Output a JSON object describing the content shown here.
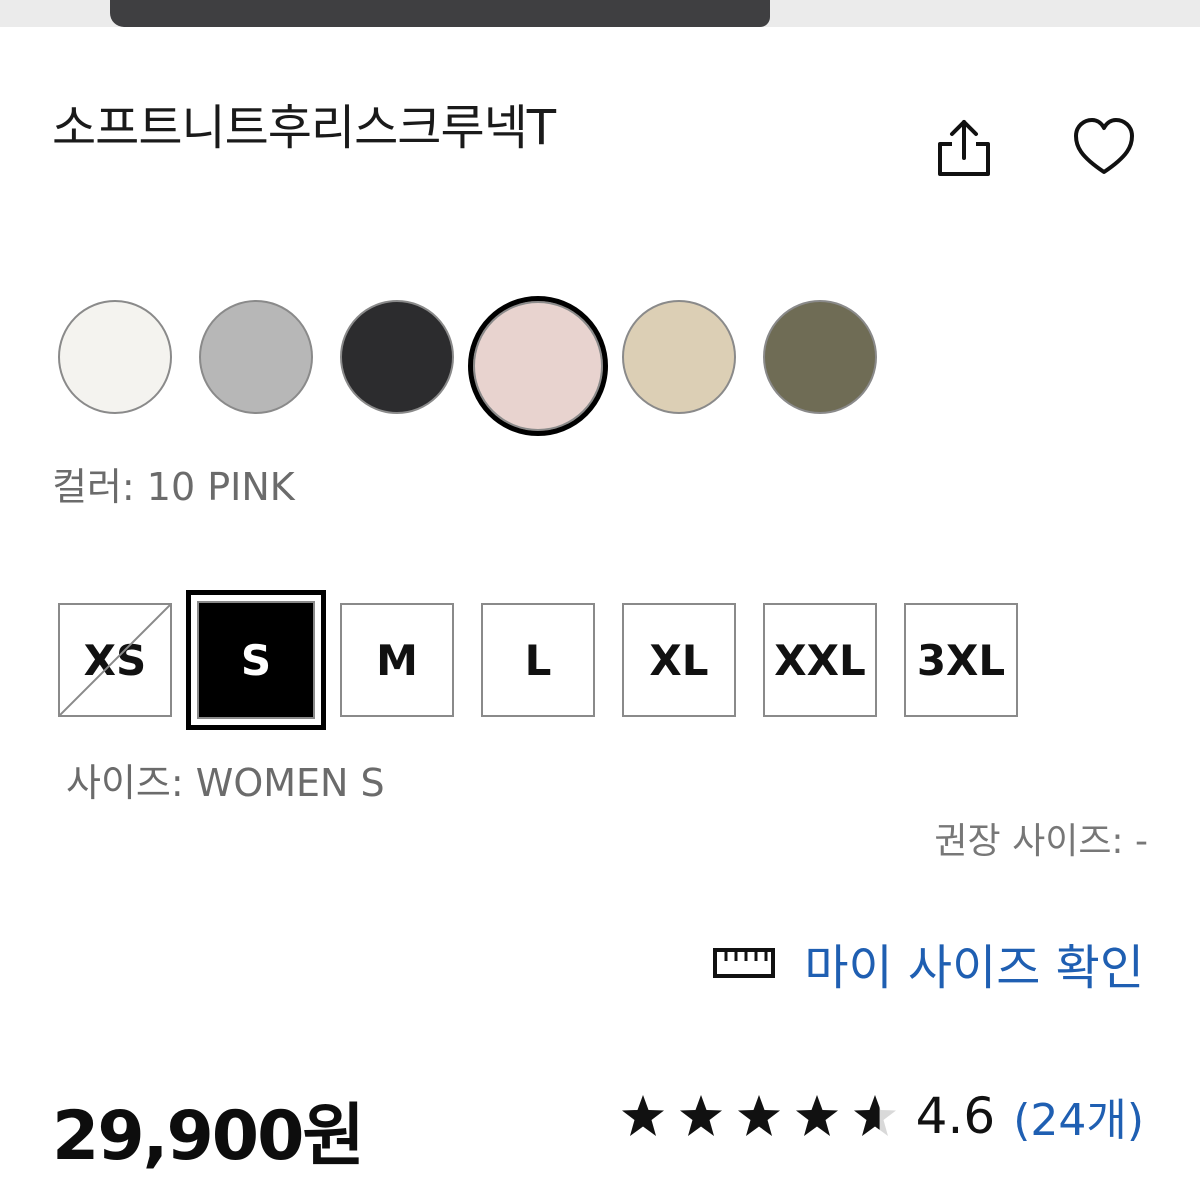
{
  "product": {
    "title": "소프트니트후리스크루넥T",
    "price": "29,900원"
  },
  "actions": {
    "share_icon": "share-icon",
    "favorite_icon": "heart-icon"
  },
  "colors": {
    "swatches": [
      {
        "name": "off-white",
        "color": "#f4f3ef"
      },
      {
        "name": "gray",
        "color": "#b7b7b7"
      },
      {
        "name": "black",
        "color": "#2c2c2e"
      },
      {
        "name": "pink",
        "color": "#e8d3cf"
      },
      {
        "name": "beige",
        "color": "#dccfb5"
      },
      {
        "name": "olive",
        "color": "#6f6c55"
      }
    ],
    "selected_index": 3,
    "label": "컬러: 10 PINK"
  },
  "sizes": {
    "options": [
      {
        "label": "XS",
        "available": false
      },
      {
        "label": "S",
        "available": true
      },
      {
        "label": "M",
        "available": true
      },
      {
        "label": "L",
        "available": true
      },
      {
        "label": "XL",
        "available": true
      },
      {
        "label": "XXL",
        "available": true
      },
      {
        "label": "3XL",
        "available": true
      }
    ],
    "selected_index": 1,
    "label": "사이즈: WOMEN S",
    "recommended": "권장 사이즈: -"
  },
  "my_size": {
    "icon": "ruler-icon",
    "label": "마이 사이즈 확인"
  },
  "rating": {
    "value": "4.6",
    "count": "(24개)",
    "stars": 4.6,
    "max_stars": 5
  },
  "theme": {
    "accent": "#1f5fb2",
    "text": "#111111",
    "muted": "#6b6b6b"
  }
}
